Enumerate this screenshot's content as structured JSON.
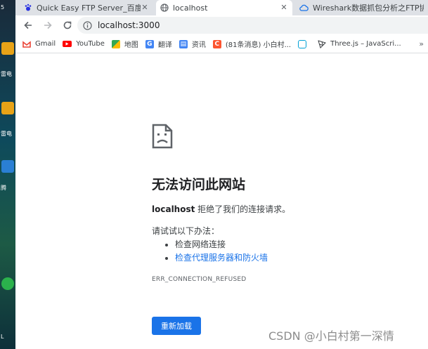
{
  "desktop": {
    "labels": [
      "5",
      "雷电",
      "雷电",
      "腾",
      "L"
    ]
  },
  "tabs": [
    {
      "title": "Quick Easy FTP Server_百度搜索",
      "icon": "baidu-paw-icon"
    },
    {
      "title": "localhost",
      "icon": "globe-icon"
    },
    {
      "title": "Wireshark数据抓包分析之FTP协",
      "icon": "cloud-icon"
    }
  ],
  "toolbar": {
    "url": "localhost:3000"
  },
  "bookmarks": [
    {
      "label": "Gmail",
      "icon": "gmail-icon",
      "color": "#ea4335"
    },
    {
      "label": "YouTube",
      "icon": "youtube-icon",
      "color": "#ff0000"
    },
    {
      "label": "地图",
      "icon": "maps-icon",
      "color": "#34a853"
    },
    {
      "label": "翻译",
      "icon": "translate-icon",
      "color": "#4285f4"
    },
    {
      "label": "资讯",
      "icon": "news-icon",
      "color": "#4285f4"
    },
    {
      "label": "(81条消息) 小白村...",
      "icon": "csdn-icon",
      "color": "#fc5531"
    },
    {
      "label": "",
      "icon": "bilibili-icon",
      "color": "#00a1d6"
    },
    {
      "label": "Three.js – JavaScri...",
      "icon": "threejs-icon",
      "color": "#3c4043"
    }
  ],
  "error": {
    "title": "无法访问此网站",
    "host": "localhost",
    "description": " 拒绝了我们的连接请求。",
    "try_label": "请试试以下办法：",
    "suggestions": [
      "检查网络连接",
      "检查代理服务器和防火墙"
    ],
    "code": "ERR_CONNECTION_REFUSED",
    "reload_label": "重新加载"
  },
  "watermark": "CSDN @小白村第一深情",
  "colors": {
    "accent": "#1a73e8",
    "tabbar": "#dee1e6"
  }
}
